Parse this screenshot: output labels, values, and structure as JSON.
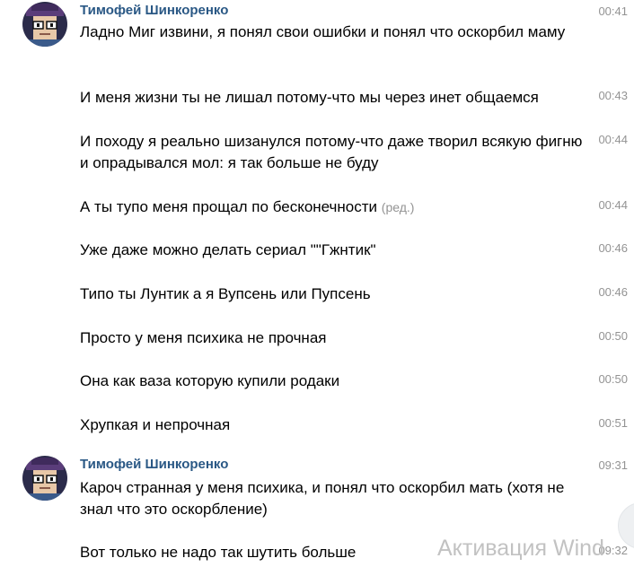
{
  "groups": [
    {
      "author": "Тимофей Шинкоренко",
      "messages": [
        {
          "text": "Ладно Миг извини, я понял свои ошибки и понял что оскорбил маму",
          "time": "00:41"
        },
        {
          "text": "И меня жизни ты не лишал потому-что мы через инет общаемся",
          "time": "00:43"
        },
        {
          "text": "И походу я реально шизанулся потому-что даже творил всякую фигню и опрадывался мол: я так больше не буду",
          "time": "00:44"
        },
        {
          "text": "А ты тупо меня прощал по бесконечности",
          "edited": "(ред.)",
          "time": "00:44"
        },
        {
          "text": "Уже даже можно делать сериал \"\"Гжнтик\"",
          "time": "00:46"
        },
        {
          "text": "Типо ты Лунтик а я Вупсень или Пупсень",
          "time": "00:46"
        },
        {
          "text": "Просто у меня психика не прочная",
          "time": "00:50"
        },
        {
          "text": "Она как ваза которую купили родаки",
          "time": "00:50"
        },
        {
          "text": "Хрупкая и непрочная",
          "time": "00:51"
        }
      ]
    },
    {
      "author": "Тимофей Шинкоренко",
      "messages": [
        {
          "text": "Кароч странная у меня психика, и понял что оскорбил мать (хотя не знал что это оскорбление)",
          "time": "09:31"
        },
        {
          "text": "Вот только не надо так шутить больше",
          "time": "09:32"
        }
      ]
    }
  ],
  "watermark": "Активация Wind",
  "colors": {
    "author": "#2a5885",
    "time": "#939393",
    "text": "#000000"
  },
  "icons": {
    "avatar": "avatar-glasses-hat-icon"
  }
}
